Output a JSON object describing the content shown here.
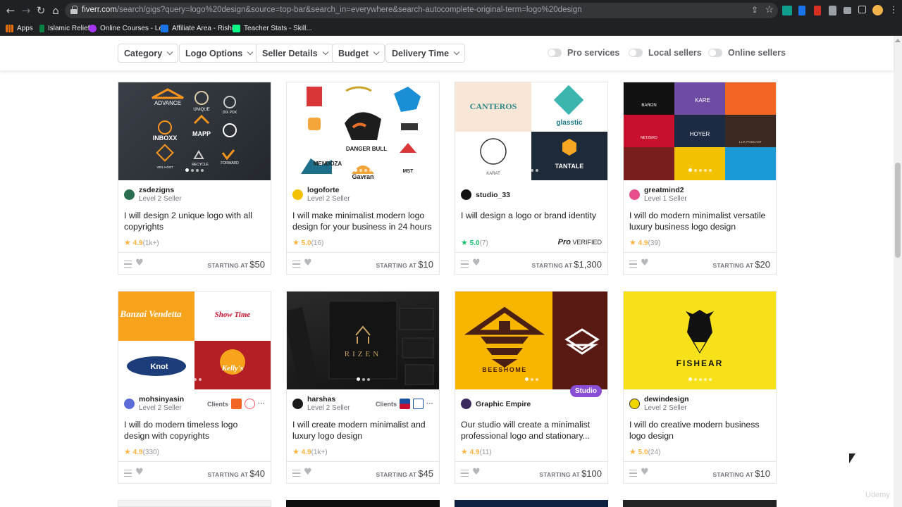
{
  "browser": {
    "url_host": "fiverr.com",
    "url_rest": "/search/gigs?query=logo%20design&source=top-bar&search_in=everywhere&search-autocomplete-original-term=logo%20design",
    "bookmarks": [
      {
        "label": "Apps",
        "icon": "apps-grid-icon",
        "color": "#e8710a"
      },
      {
        "label": "Islamic Relief",
        "icon": "islamic-relief-icon",
        "color": "#0b8043"
      },
      {
        "label": "Online Courses - Le...",
        "icon": "udemy-icon",
        "color": "#a435f0"
      },
      {
        "label": "Affiliate Area - Rishi...",
        "icon": "affiliate-icon",
        "color": "#1a73e8"
      },
      {
        "label": "Teacher Stats - Skill...",
        "icon": "skillshare-icon",
        "color": "#00ff84"
      }
    ]
  },
  "filters": {
    "dropdowns": [
      "Category",
      "Logo Options",
      "Seller Details",
      "Budget",
      "Delivery Time"
    ],
    "toggles": [
      "Pro services",
      "Local sellers",
      "Online sellers"
    ]
  },
  "price_label": "STARTING AT",
  "gigs": [
    {
      "seller": "zsdezigns",
      "level": "Level 2 Seller",
      "title": "I will design 2 unique logo with all copyrights",
      "rating": "4.9",
      "count": "(1k+)",
      "price": "$50",
      "avatar_color": "#2a6e4f"
    },
    {
      "seller": "logoforte",
      "level": "Level 2 Seller",
      "title": "I will make minimalist modern logo design for your business in 24 hours",
      "rating": "5.0",
      "count": "(16)",
      "price": "$10",
      "avatar_color": "#f2c200"
    },
    {
      "seller": "studio_33",
      "level": "",
      "title": "I will design a logo or brand identity",
      "rating": "5.0",
      "count": "(7)",
      "price": "$1,300",
      "avatar_color": "#111111",
      "pro_badge": "Pro",
      "pro_text": "VERIFIED"
    },
    {
      "seller": "greatmind2",
      "level": "Level 1 Seller",
      "title": "I will do modern minimalist versatile luxury business logo design",
      "rating": "4.9",
      "count": "(39)",
      "price": "$20",
      "avatar_color": "#e84c8b"
    },
    {
      "seller": "mohsinyasin",
      "level": "Level 2 Seller",
      "title": "I will do modern timeless logo design with copyrights",
      "rating": "4.9",
      "count": "(330)",
      "price": "$40",
      "avatar_color": "#5b6bd8",
      "clients_label": "Clients"
    },
    {
      "seller": "harshas",
      "level": "Level 2 Seller",
      "title": "I will create modern minimalist and luxury logo design",
      "rating": "4.9",
      "count": "(1k+)",
      "price": "$45",
      "avatar_color": "#1a1a1a",
      "clients_label": "Clients"
    },
    {
      "seller": "Graphic Empire",
      "level": "",
      "title": "Our studio will create a minimalist professional logo and stationary...",
      "rating": "4.9",
      "count": "(11)",
      "price": "$100",
      "avatar_color": "#3b2a5e",
      "badge": "Studio"
    },
    {
      "seller": "dewindesign",
      "level": "Level 2 Seller",
      "title": "I will do creative modern business logo design",
      "rating": "5.0",
      "count": "(24)",
      "price": "$10",
      "avatar_color": "#f2d600"
    }
  ],
  "thumbnail_text": {
    "g1": [
      "ADVANCE",
      "UNIQUE",
      "DIX POX",
      "INBOXX",
      "MAPP",
      "VEIL HOST",
      "RECYCLE",
      "FORWARD"
    ],
    "g2": [
      "DANGER BULL",
      "MENDOZA",
      "Gavran",
      "MST"
    ],
    "g3": [
      "CANTEROS",
      "glasstic",
      "KARAT",
      "TANTALE"
    ],
    "g4": [
      "BARON",
      "KARE",
      "NETZERO",
      "HOYER",
      "LUX PODCAST"
    ],
    "g5": [
      "Banzai Vendetta",
      "Show Time",
      "Knot",
      "Kelly's"
    ],
    "g6": [
      "RIZEN"
    ],
    "g7": [
      "BEESHOME"
    ],
    "g8": [
      "FISHEAR"
    ]
  },
  "watermark": "Udemy"
}
